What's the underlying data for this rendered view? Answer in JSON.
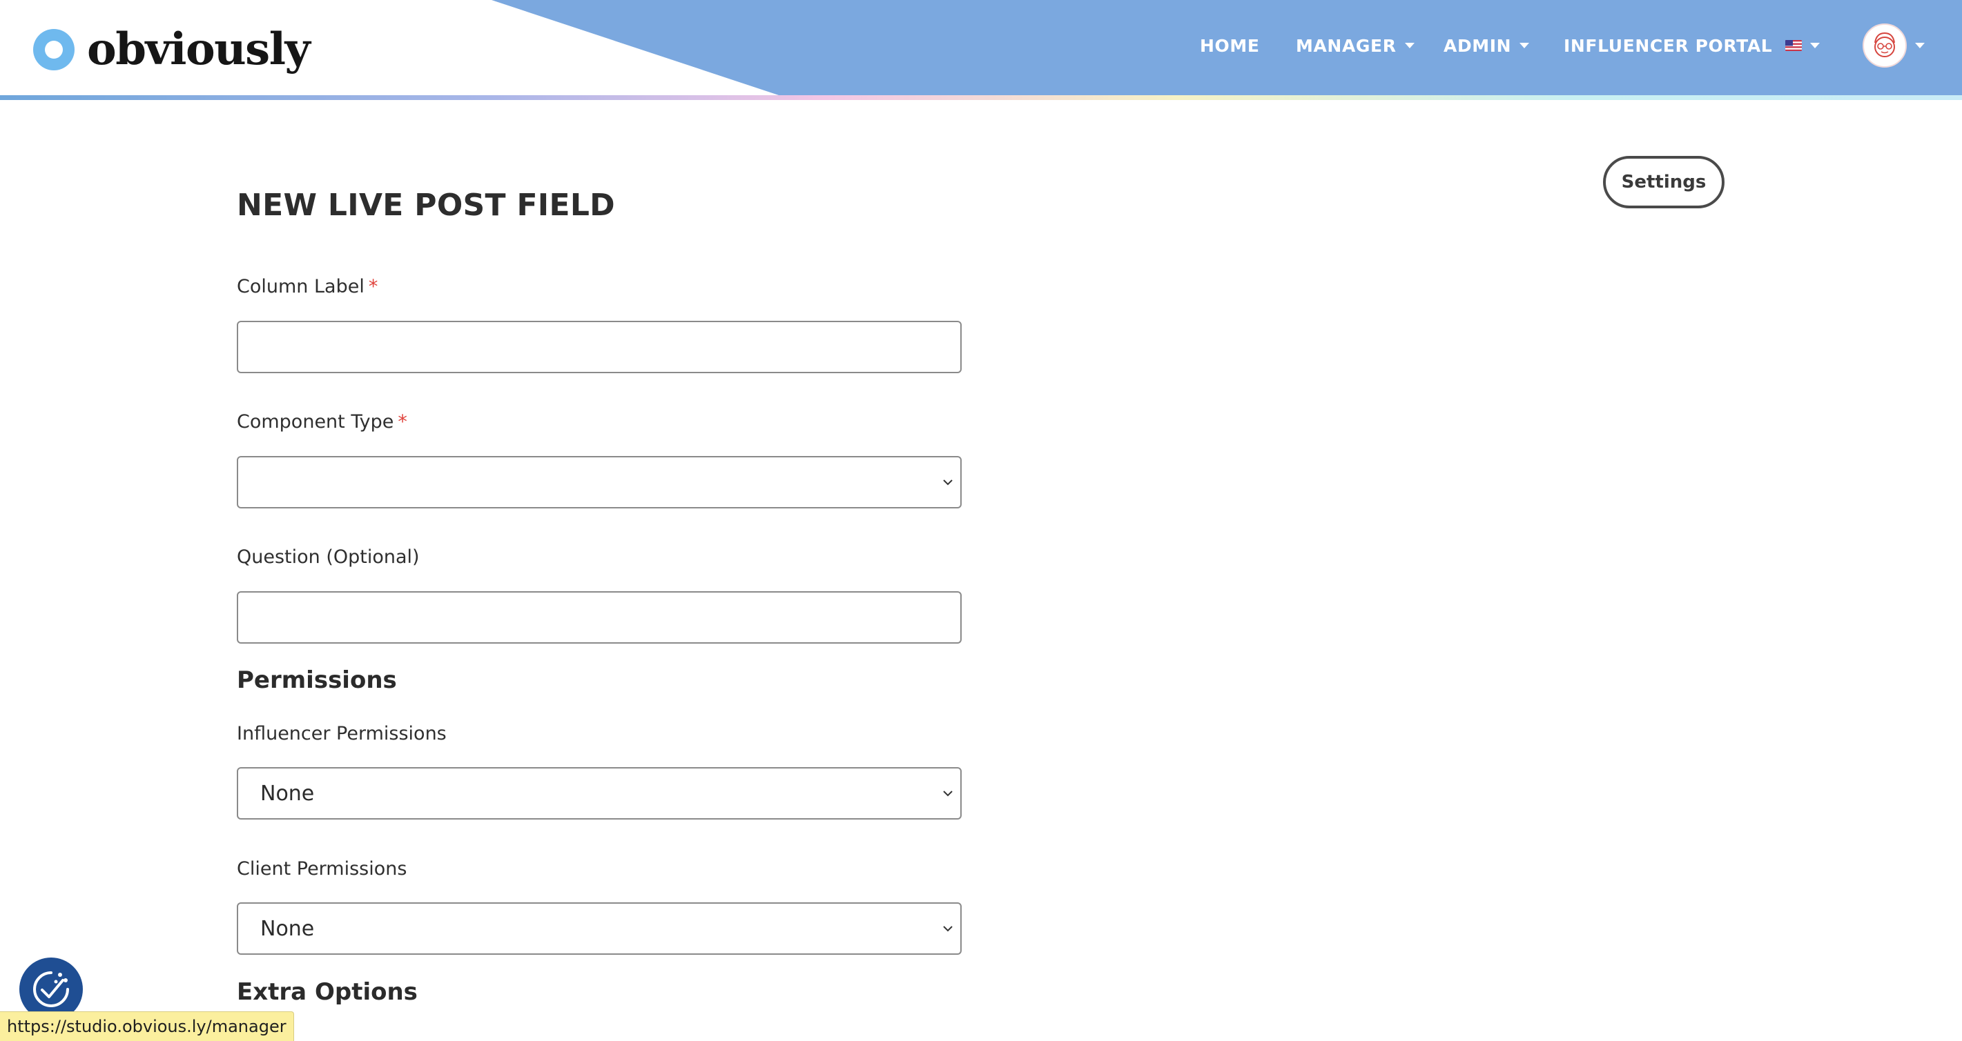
{
  "header": {
    "brand_name": "obviously",
    "nav": {
      "home": "HOME",
      "manager": "MANAGER",
      "admin": "ADMIN",
      "influencer_portal": "INFLUENCER PORTAL"
    },
    "language_icon": "us-flag-icon",
    "account_icon": "user-avatar"
  },
  "settings_button": "Settings",
  "form": {
    "title": "NEW LIVE POST FIELD",
    "column_label": {
      "label": "Column Label",
      "required_mark": "*",
      "value": ""
    },
    "component_type": {
      "label": "Component Type",
      "required_mark": "*",
      "selected": ""
    },
    "question": {
      "label": "Question (Optional)",
      "value": ""
    },
    "permissions_heading": "Permissions",
    "influencer_permissions": {
      "label": "Influencer Permissions",
      "selected": "None"
    },
    "client_permissions": {
      "label": "Client Permissions",
      "selected": "None"
    },
    "extra_options_heading": "Extra Options"
  },
  "status_bar_url": "https://studio.obvious.ly/manager",
  "colors": {
    "header_blue": "#7ba8df",
    "accessibility_button": "#1f4e93",
    "required_mark": "#e0443d",
    "status_bar_bg": "#fbef9e"
  }
}
